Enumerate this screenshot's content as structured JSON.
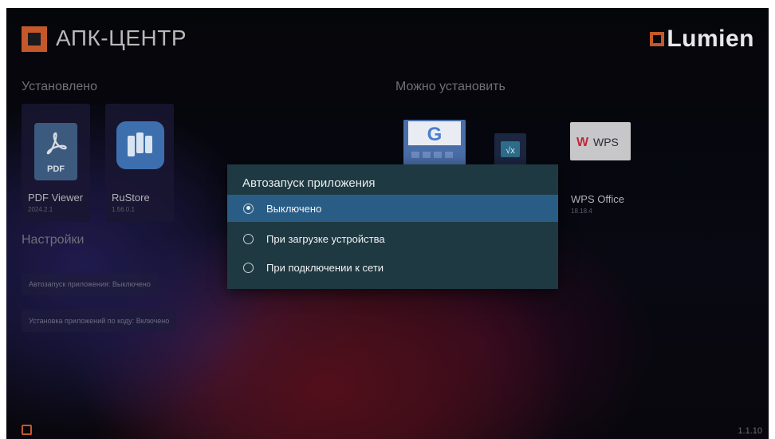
{
  "header": {
    "app_title": "АПК-ЦЕНТР",
    "brand": "Lumien"
  },
  "installed": {
    "title": "Установлено",
    "apps": [
      {
        "name": "PDF Viewer",
        "version": "2024.2.1",
        "icon": "pdf-icon",
        "icon_text": "PDF"
      },
      {
        "name": "RuStore",
        "version": "1.56.0.1",
        "icon": "rustore-icon"
      }
    ]
  },
  "available": {
    "title": "Можно установить",
    "apps": [
      {
        "icon": "google-keyboard-icon",
        "name": ""
      },
      {
        "icon": "calculator-icon",
        "name": ""
      },
      {
        "icon": "wps-office-icon",
        "name": "WPS Office",
        "version": "18.18.4",
        "icon_text": "WPS"
      }
    ]
  },
  "settings": {
    "title": "Настройки",
    "items": [
      {
        "label": "Автозапуск приложения: Выключено"
      },
      {
        "label": "Установка приложений по коду: Включено"
      }
    ]
  },
  "dialog": {
    "title": "Автозапуск приложения",
    "options": [
      {
        "label": "Выключено",
        "selected": true
      },
      {
        "label": "При загрузке устройства",
        "selected": false
      },
      {
        "label": "При подключении к сети",
        "selected": false
      }
    ]
  },
  "footer": {
    "version": "1.1.10",
    "exit_icon": "exit-icon"
  },
  "colors": {
    "accent": "#c4582b",
    "dialog_bg": "#1f3942",
    "selected_option": "#2a5d86"
  }
}
